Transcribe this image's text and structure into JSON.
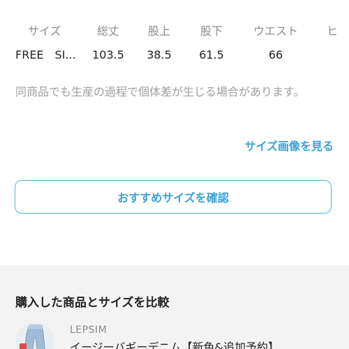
{
  "size_table": {
    "headers": [
      "サイズ",
      "総丈",
      "股上",
      "股下",
      "ウエスト",
      "ヒ"
    ],
    "rows": [
      [
        "FREE　SI...",
        "103.5",
        "38.5",
        "61.5",
        "66",
        ""
      ]
    ]
  },
  "disclaimer": "同商品でも生産の過程で個体差が生じる場合があります。",
  "size_image_link": "サイズ画像を見る",
  "recommend_button": "おすすめサイズを確認",
  "compare": {
    "title": "購入した商品とサイズを比較",
    "product": {
      "brand": "LEPSIM",
      "name": "イージーバギーデニム【新色&追加予約】",
      "thumb_icon": "denim-pants-thumbnail"
    }
  },
  "colors": {
    "accent": "#3aa0d6",
    "button_border": "#54b1e0",
    "muted_text": "#9e9e9e",
    "section_bg": "#f3f3f3"
  }
}
